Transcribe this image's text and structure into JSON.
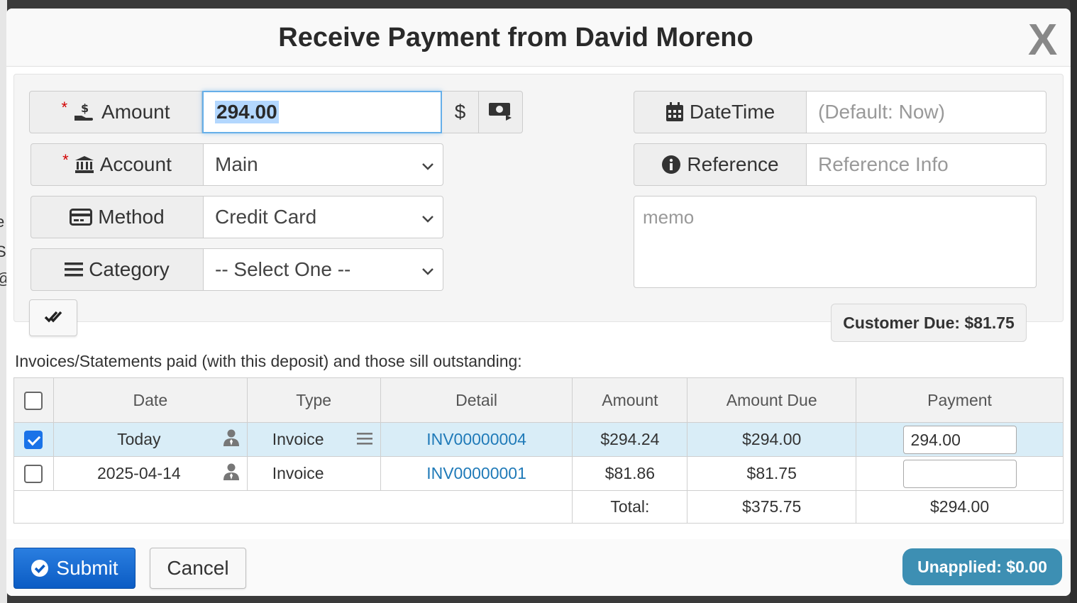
{
  "dialog": {
    "title": "Receive Payment from David Moreno",
    "close_label": "X"
  },
  "form": {
    "amount": {
      "label": "Amount",
      "value": "294.00",
      "currency": "$",
      "required": true
    },
    "account": {
      "label": "Account",
      "value": "Main",
      "required": true
    },
    "method": {
      "label": "Method",
      "value": "Credit Card"
    },
    "category": {
      "label": "Category",
      "value": "-- Select One --"
    },
    "datetime": {
      "label": "DateTime",
      "placeholder": "(Default: Now)"
    },
    "reference": {
      "label": "Reference",
      "placeholder": "Reference Info"
    },
    "memo": {
      "placeholder": "memo"
    },
    "required_mark": "*"
  },
  "customer_due": "Customer Due: $81.75",
  "invoices": {
    "caption": "Invoices/Statements paid (with this deposit) and those sill outstanding:",
    "columns": [
      "Date",
      "Type",
      "Detail",
      "Amount",
      "Amount Due",
      "Payment"
    ],
    "rows": [
      {
        "checked": true,
        "date": "Today",
        "type": "Invoice",
        "detail": "INV00000004",
        "amount": "$294.24",
        "amount_due": "$294.00",
        "payment": "294.00"
      },
      {
        "checked": false,
        "date": "2025-04-14",
        "type": "Invoice",
        "detail": "INV00000001",
        "amount": "$81.86",
        "amount_due": "$81.75",
        "payment": ""
      }
    ],
    "total_label": "Total:",
    "total_amount_due": "$375.75",
    "total_payment": "$294.00"
  },
  "footer": {
    "submit_label": "Submit",
    "cancel_label": "Cancel",
    "unapplied": "Unapplied: $0.00"
  },
  "colors": {
    "primary": "#0b5cc4",
    "selected_row": "#d9edf7",
    "link": "#1f7ab8",
    "badge": "#3d8fb3",
    "required": "#d20000"
  }
}
